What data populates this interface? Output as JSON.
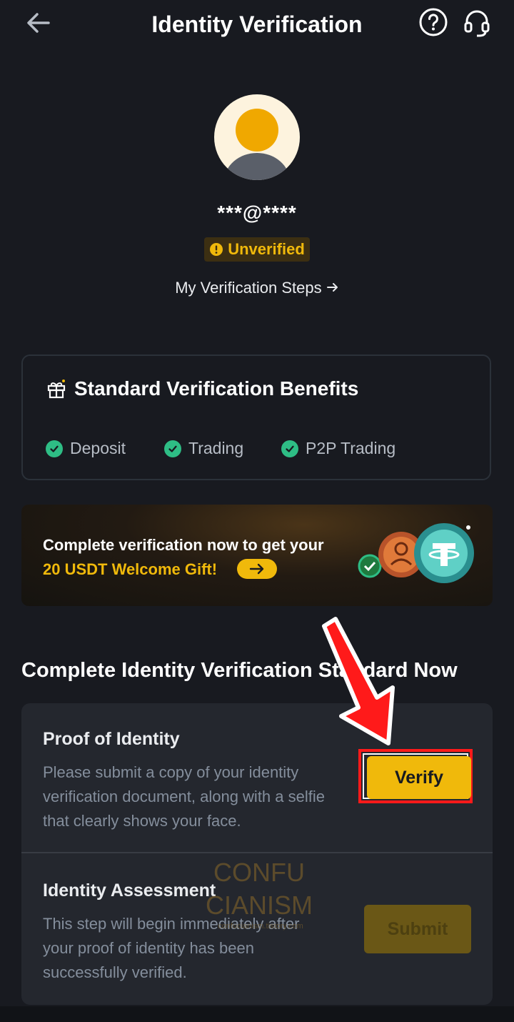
{
  "header": {
    "title": "Identity Verification"
  },
  "profile": {
    "email": "***@****",
    "status": "Unverified",
    "steps_link": "My Verification Steps"
  },
  "benefits": {
    "title": "Standard Verification Benefits",
    "items": [
      "Deposit",
      "Trading",
      "P2P Trading"
    ]
  },
  "banner": {
    "line1": "Complete verification now to get your",
    "line2": "20 USDT Welcome Gift!"
  },
  "section": {
    "title": "Complete Identity Verification Standard Now"
  },
  "steps": [
    {
      "title": "Proof of Identity",
      "description": "Please submit a copy of your identity verification document, along with a selfie that clearly shows your face.",
      "button": "Verify"
    },
    {
      "title": "Identity Assessment",
      "description": "This step will begin immediately after your proof of identity has been successfully verified.",
      "button": "Submit"
    }
  ],
  "watermark": {
    "text": "CONFU CIANISM",
    "sub": "confucianism.tistory.com"
  },
  "colors": {
    "accent": "#f0b90b",
    "success": "#2ebd85",
    "background": "#181a20",
    "annotation": "#ff1a1a"
  },
  "icons": [
    "back-arrow-icon",
    "help-icon",
    "headset-icon",
    "gift-icon",
    "check-icon",
    "arrow-right-icon",
    "usdt-coin-icon"
  ]
}
